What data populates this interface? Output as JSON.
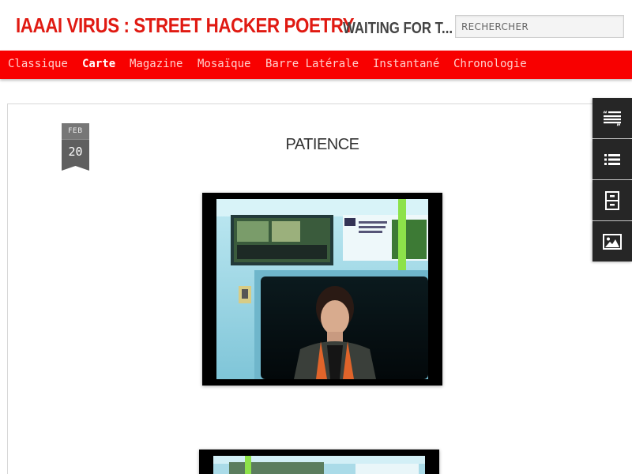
{
  "header": {
    "site_title": "IAAAI VIRUS : STREET HACKER POETRY",
    "tagline": "WAITING FOR T...",
    "search_placeholder": "RECHERCHER"
  },
  "nav": {
    "items": [
      {
        "label": "Classique",
        "active": false
      },
      {
        "label": "Carte",
        "active": true
      },
      {
        "label": "Magazine",
        "active": false
      },
      {
        "label": "Mosaïque",
        "active": false
      },
      {
        "label": "Barre Latérale",
        "active": false
      },
      {
        "label": "Instantané",
        "active": false
      },
      {
        "label": "Chronologie",
        "active": false
      }
    ]
  },
  "post": {
    "date_month": "FEB",
    "date_day": "20",
    "title": "PATIENCE"
  },
  "side_buttons": [
    {
      "icon": "blockquote-icon"
    },
    {
      "icon": "list-icon"
    },
    {
      "icon": "archive-icon"
    },
    {
      "icon": "image-icon"
    }
  ],
  "colors": {
    "brand_red": "#e01a12",
    "nav_bg": "#f80000",
    "side_btn_bg": "#262626",
    "ribbon_gray": "#5f5f5f"
  }
}
